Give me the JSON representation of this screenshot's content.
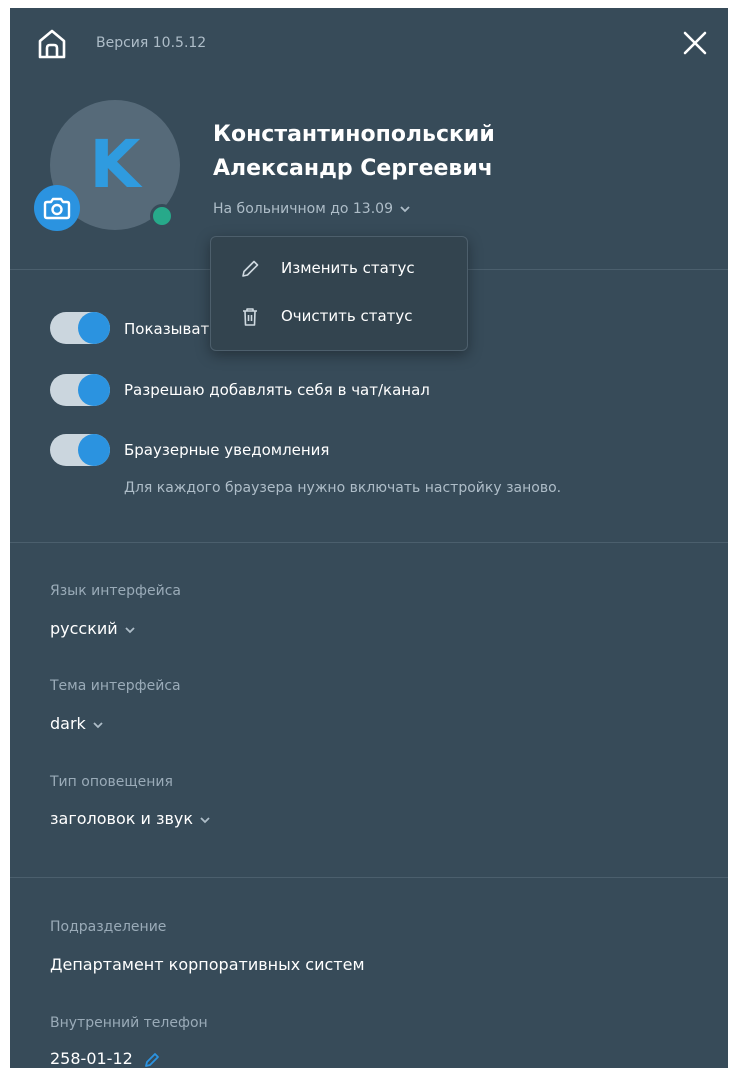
{
  "header": {
    "version_label": "Версия 10.5.12"
  },
  "profile": {
    "avatar_letter": "K",
    "name": "Константинопольский Александр Сергеевич",
    "status": "На больничном до 13.09"
  },
  "status_menu": {
    "items": [
      {
        "label": "Изменить статус",
        "icon": "pencil-icon"
      },
      {
        "label": "Очистить статус",
        "icon": "trash-icon"
      }
    ]
  },
  "toggles": [
    {
      "label": "Показывать",
      "on": true
    },
    {
      "label": "Разрешаю добавлять себя в чат/канал",
      "on": true
    },
    {
      "label": "Браузерные уведомления",
      "on": true,
      "hint": "Для каждого браузера нужно включать настройку заново."
    }
  ],
  "settings": {
    "language": {
      "label": "Язык интерфейса",
      "value": "русский"
    },
    "theme": {
      "label": "Тема интерфейса",
      "value": "dark"
    },
    "notification": {
      "label": "Тип оповещения",
      "value": "заголовок и звук"
    }
  },
  "info": {
    "department": {
      "label": "Подразделение",
      "value": "Департамент корпоративных систем"
    },
    "phone": {
      "label": "Внутренний телефон",
      "value": "258-01-12"
    }
  },
  "colors": {
    "panel_bg": "#374b59",
    "accent": "#2b93e0",
    "online": "#27a98a",
    "muted_text": "#aebdc8"
  }
}
